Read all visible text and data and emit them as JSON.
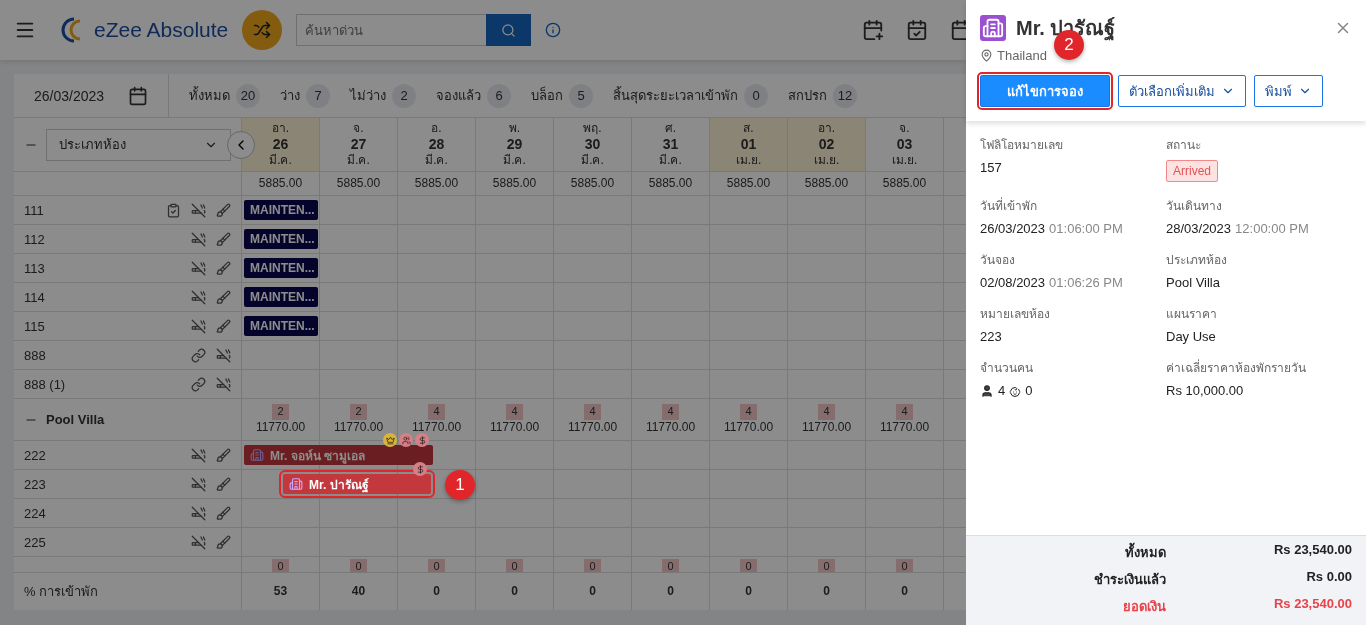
{
  "topbar": {
    "brand": "eZee Absolute",
    "search": {
      "placeholder": "ค้นหาด่วน"
    }
  },
  "stats_bar": {
    "date": "26/03/2023",
    "stats": [
      {
        "label": "ทั้งหมด",
        "count": "20"
      },
      {
        "label": "ว่าง",
        "count": "7"
      },
      {
        "label": "ไม่ว่าง",
        "count": "2"
      },
      {
        "label": "จองแล้ว",
        "count": "6"
      },
      {
        "label": "บล็อก",
        "count": "5"
      },
      {
        "label": "สิ้นสุดระยะเวลาเข้าพัก",
        "count": "0"
      },
      {
        "label": "สกปรก",
        "count": "12"
      }
    ]
  },
  "grid": {
    "room_type_select": "ประเภทห้อง",
    "days": [
      {
        "weekday": "อา.",
        "day": "26",
        "month": "มี.ค.",
        "weekend": true
      },
      {
        "weekday": "จ.",
        "day": "27",
        "month": "มี.ค.",
        "weekend": false
      },
      {
        "weekday": "อ.",
        "day": "28",
        "month": "มี.ค.",
        "weekend": false
      },
      {
        "weekday": "พ.",
        "day": "29",
        "month": "มี.ค.",
        "weekend": false
      },
      {
        "weekday": "พฤ.",
        "day": "30",
        "month": "มี.ค.",
        "weekend": false
      },
      {
        "weekday": "ศ.",
        "day": "31",
        "month": "มี.ค.",
        "weekend": false
      },
      {
        "weekday": "ส.",
        "day": "01",
        "month": "เม.ย.",
        "weekend": true
      },
      {
        "weekday": "อา.",
        "day": "02",
        "month": "เม.ย.",
        "weekend": true
      },
      {
        "weekday": "จ.",
        "day": "03",
        "month": "เม.ย.",
        "weekend": false
      }
    ],
    "groups": [
      {
        "prices": [
          "5885.00",
          "5885.00",
          "5885.00",
          "5885.00",
          "5885.00",
          "5885.00",
          "5885.00",
          "5885.00",
          "5885.00"
        ],
        "rooms": [
          {
            "number": "111",
            "icons": [
              {
                "kind": "checklist"
              },
              {
                "kind": "no-smoking"
              },
              {
                "kind": "cleaning"
              }
            ],
            "bookings": [
              {
                "kind": "maintenance",
                "label": "MAINTEN..."
              }
            ]
          },
          {
            "number": "112",
            "icons": [
              {
                "kind": "no-smoking"
              },
              {
                "kind": "cleaning"
              }
            ],
            "bookings": [
              {
                "kind": "maintenance",
                "label": "MAINTEN..."
              }
            ]
          },
          {
            "number": "113",
            "icons": [
              {
                "kind": "no-smoking"
              },
              {
                "kind": "cleaning"
              }
            ],
            "bookings": [
              {
                "kind": "maintenance",
                "label": "MAINTEN..."
              }
            ]
          },
          {
            "number": "114",
            "icons": [
              {
                "kind": "no-smoking"
              },
              {
                "kind": "cleaning"
              }
            ],
            "bookings": [
              {
                "kind": "maintenance",
                "label": "MAINTEN..."
              }
            ]
          },
          {
            "number": "115",
            "icons": [
              {
                "kind": "no-smoking"
              },
              {
                "kind": "cleaning"
              }
            ],
            "bookings": [
              {
                "kind": "maintenance",
                "label": "MAINTEN..."
              }
            ]
          },
          {
            "number": "888",
            "icons": [
              {
                "kind": "link"
              },
              {
                "kind": "no-smoking"
              }
            ]
          },
          {
            "number": "888 (1)",
            "icons": [
              {
                "kind": "link"
              },
              {
                "kind": "no-smoking"
              }
            ]
          }
        ]
      },
      {
        "name": "Pool Villa",
        "badges": [
          "2",
          "2",
          "4",
          "4",
          "4",
          "4",
          "4",
          "4",
          "4"
        ],
        "prices": [
          "11770.00",
          "11770.00",
          "11770.00",
          "11770.00",
          "11770.00",
          "11770.00",
          "11770.00",
          "11770.00",
          "11770.00"
        ],
        "rooms": [
          {
            "number": "222",
            "icons": [
              {
                "kind": "no-smoking"
              },
              {
                "kind": "cleaning"
              }
            ],
            "bookings": [
              {
                "kind": "reservation",
                "label": "Mr. จอห์น ซามูเอล",
                "flags": [
                  {
                    "kind": "vip"
                  },
                  {
                    "kind": "group"
                  },
                  {
                    "kind": "payment"
                  }
                ],
                "highlighted": false
              }
            ]
          },
          {
            "number": "223",
            "icons": [
              {
                "kind": "no-smoking"
              },
              {
                "kind": "cleaning"
              }
            ],
            "bookings": [
              {
                "kind": "reservation",
                "label": "Mr. ปารัณฐ์",
                "flags": [
                  {
                    "kind": "payment"
                  }
                ],
                "highlighted": true,
                "marker": "1"
              }
            ]
          },
          {
            "number": "224",
            "icons": [
              {
                "kind": "no-smoking"
              },
              {
                "kind": "cleaning"
              }
            ]
          },
          {
            "number": "225",
            "icons": [
              {
                "kind": "no-smoking"
              },
              {
                "kind": "cleaning"
              }
            ]
          }
        ]
      },
      {
        "badges": [
          "0",
          "0",
          "0",
          "0",
          "0",
          "0",
          "0",
          "0",
          "0"
        ]
      }
    ],
    "footer": {
      "label": "% การเข้าพัก",
      "values": [
        "53",
        "40",
        "0",
        "0",
        "0",
        "0",
        "0",
        "0",
        "0"
      ]
    }
  },
  "panel": {
    "guest": "Mr. ปารัณฐ์",
    "country": "Thailand",
    "marker": "2",
    "buttons": [
      {
        "label": "แก้ไขการจอง",
        "kind": "primary",
        "highlighted": true
      },
      {
        "label": "ตัวเลือกเพิ่มเติม",
        "kind": "dropdown",
        "highlighted": false
      },
      {
        "label": "พิมพ์",
        "kind": "dropdown",
        "highlighted": false
      }
    ],
    "fields": [
      {
        "label": "โฟลิโอหมายเลข",
        "value": "157"
      },
      {
        "label": "สถานะ",
        "status": "Arrived"
      },
      {
        "label": "วันที่เข้าพัก",
        "value": "26/03/2023",
        "time": "01:06:00 PM"
      },
      {
        "label": "วันเดินทาง",
        "value": "28/03/2023",
        "time": "12:00:00 PM"
      },
      {
        "label": "วันจอง",
        "value": "02/08/2023",
        "time": "01:06:26 PM"
      },
      {
        "label": "ประเภทห้อง",
        "value": "Pool Villa"
      },
      {
        "label": "หมายเลขห้อง",
        "value": "223"
      },
      {
        "label": "แผนราคา",
        "value": "Day Use"
      },
      {
        "label": "จำนวนคน",
        "adults": "4",
        "children": "0"
      },
      {
        "label": "ค่าเฉลี่ยราคาห้องพักรายวัน",
        "value": "Rs 10,000.00"
      }
    ],
    "totals": [
      {
        "label": "ทั้งหมด",
        "amount": "Rs 23,540.00",
        "due": false
      },
      {
        "label": "ชำระเงินแล้ว",
        "amount": "Rs 0.00",
        "due": false
      },
      {
        "label": "ยอดเงิน",
        "amount": "Rs 23,540.00",
        "due": true
      }
    ]
  }
}
